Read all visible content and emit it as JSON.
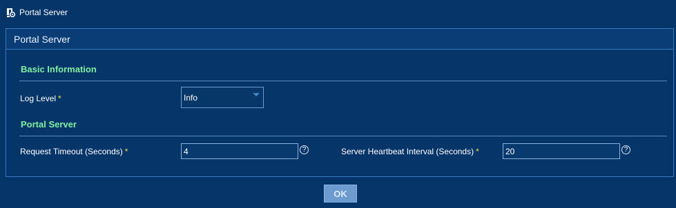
{
  "header": {
    "title": "Portal Server",
    "icon": "portal-server-icon"
  },
  "panel": {
    "title": "Portal Server"
  },
  "basic_info": {
    "heading": "Basic Information",
    "log_level": {
      "label": "Log Level",
      "required_mark": "*",
      "value": "Info"
    }
  },
  "portal_server": {
    "heading": "Portal Server",
    "request_timeout": {
      "label": "Request Timeout (Seconds)",
      "required_mark": "*",
      "value": "4",
      "help": "?"
    },
    "heartbeat_interval": {
      "label": "Server Heartbeat Interval (Seconds)",
      "required_mark": "*",
      "value": "20",
      "help": "?"
    }
  },
  "actions": {
    "ok_label": "OK"
  },
  "colors": {
    "background": "#06356a",
    "heading_green": "#7ff0a0",
    "required_yellow": "#ffdc3c",
    "button": "#6d9bd0"
  }
}
